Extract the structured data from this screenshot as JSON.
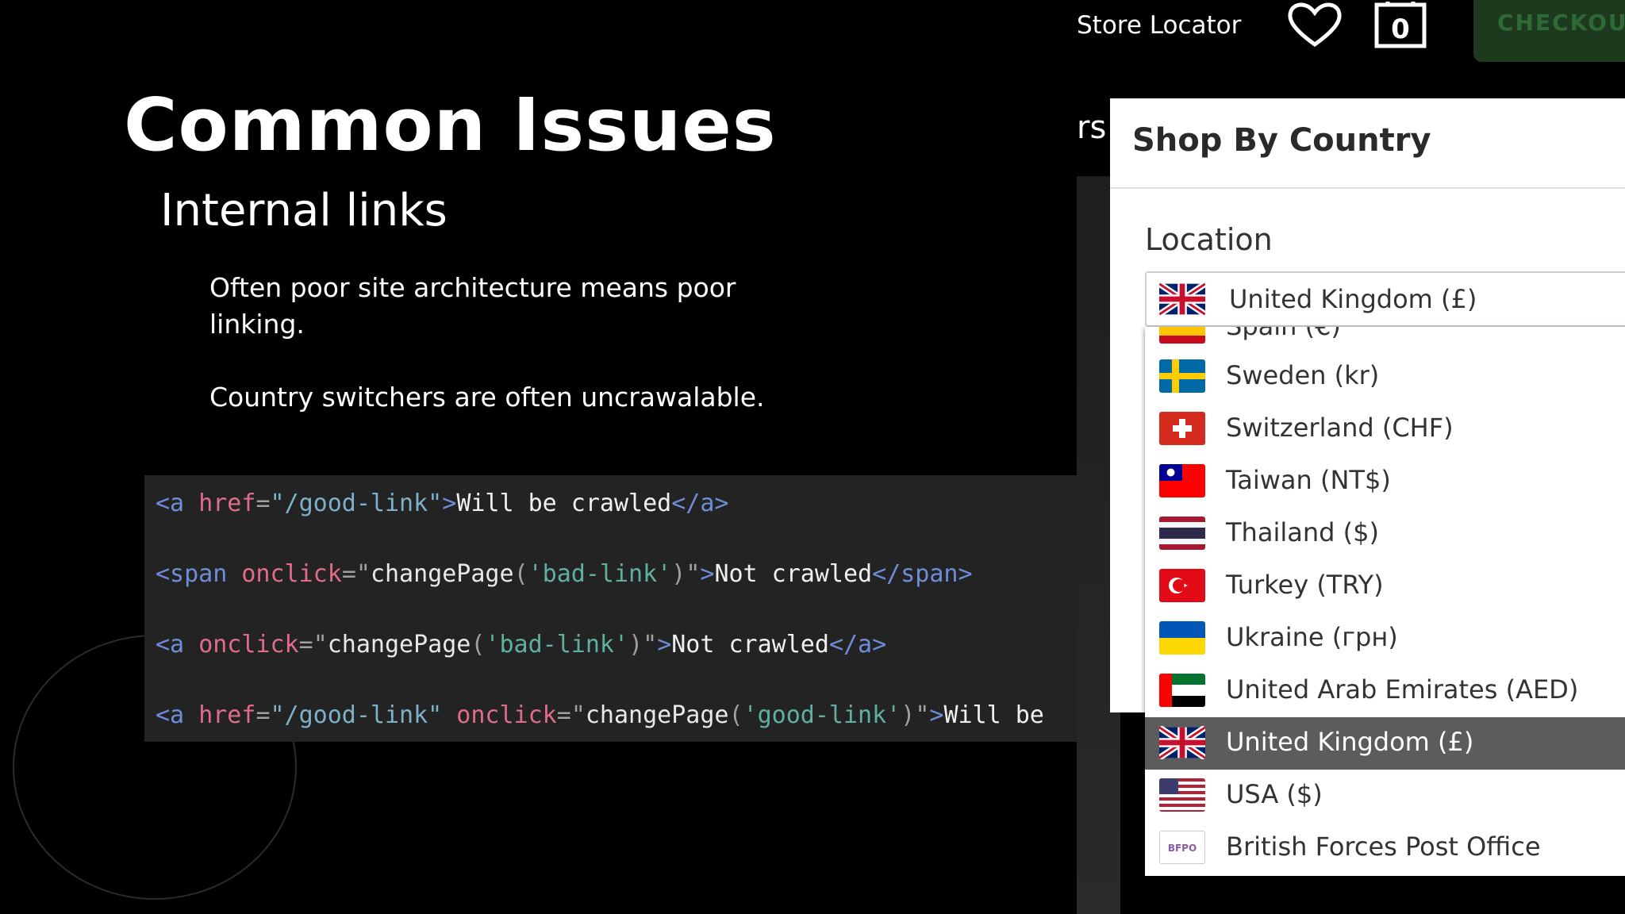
{
  "slide": {
    "title": "Common Issues",
    "subtitle": "Internal links",
    "bullets": [
      "Often poor site architecture means poor linking.",
      "Country switchers are often uncrawalable."
    ]
  },
  "code": {
    "line1": {
      "open": "<a ",
      "attr": "href",
      "eq": "=",
      "str": "\"/good-link\"",
      "close": ">",
      "text": "Will be crawled",
      "end": "</a>"
    },
    "line2": {
      "open": "<span ",
      "attr": "onclick",
      "eq": "=",
      "q1": "\"",
      "fn": "changePage",
      "p1": "(",
      "arg": "'bad-link'",
      "p2": ")",
      "q2": "\"",
      "close": ">",
      "text": "Not crawled",
      "end": "</span>"
    },
    "line3": {
      "open": "<a ",
      "attr": "onclick",
      "eq": "=",
      "q1": "\"",
      "fn": "changePage",
      "p1": "(",
      "arg": "'bad-link'",
      "p2": ")",
      "q2": "\"",
      "close": ">",
      "text": "Not crawled",
      "end": "</a>"
    },
    "line4": {
      "open": "<a ",
      "attr1": "href",
      "eq1": "=",
      "str1": "\"/good-link\"",
      "attr2": " onclick",
      "eq2": "=",
      "q1": "\"",
      "fn": "changePage",
      "p1": "(",
      "arg": "'good-link'",
      "p2": ")",
      "q2": "\"",
      "close": ">",
      "text": "Will be"
    }
  },
  "site": {
    "store_locator": "Store Locator",
    "bag_count": "0",
    "checkout": "CHECKOUT",
    "partial_text": "rs",
    "modal_title": "Shop By Country",
    "location_label": "Location",
    "selected_value": "United Kingdom (£)",
    "options": [
      {
        "label": "Spain (€)",
        "flag": "spain"
      },
      {
        "label": "Sweden (kr)",
        "flag": "sweden"
      },
      {
        "label": "Switzerland (CHF)",
        "flag": "switzerland"
      },
      {
        "label": "Taiwan (NT$)",
        "flag": "taiwan"
      },
      {
        "label": "Thailand ($)",
        "flag": "thailand"
      },
      {
        "label": "Turkey (TRY)",
        "flag": "turkey"
      },
      {
        "label": "Ukraine (грн)",
        "flag": "ukraine"
      },
      {
        "label": "United Arab Emirates (AED)",
        "flag": "uae"
      },
      {
        "label": "United Kingdom (£)",
        "flag": "uk"
      },
      {
        "label": "USA ($)",
        "flag": "usa"
      },
      {
        "label": "British Forces Post Office",
        "flag": "bfpo"
      }
    ],
    "bfpo_logo_text": "BFPO"
  },
  "colors": {
    "background": "#000000",
    "code_bg": "#232323",
    "selected_option": "#5c5c5c",
    "checkout_bg": "#1d3a1f"
  }
}
